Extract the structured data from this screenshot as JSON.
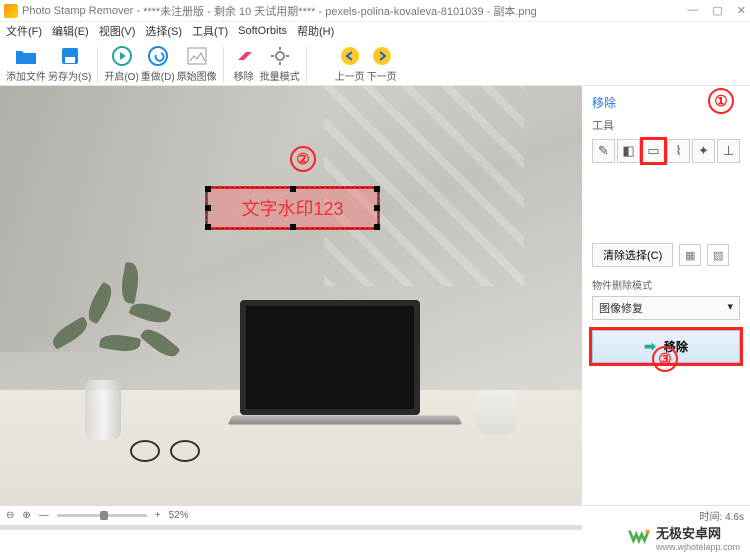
{
  "titlebar": {
    "app_name": "Photo Stamp Remover",
    "doc_status": "****未注册版 - 剩余 10 天试用期**** - pexels-polina-kovaleva-8101039 - 副本.png"
  },
  "menu": {
    "file": "文件(F)",
    "edit": "编辑(E)",
    "view": "视图(V)",
    "select": "选择(S)",
    "tools": "工具(T)",
    "softorbits": "SoftOrbits",
    "help": "帮助(H)"
  },
  "toolbar": {
    "add_file": "添加文件",
    "save_as": "另存为(S)",
    "start": "开启(O)",
    "undo": "重做(D)",
    "original": "原始图像",
    "remove": "移除",
    "batch": "批量模式",
    "prev": "上一页",
    "next": "下一页"
  },
  "canvas": {
    "watermark_text": "文字水印123"
  },
  "annotations": {
    "one": "①",
    "two": "②",
    "three": "③"
  },
  "sidebar": {
    "title": "移除",
    "tools_label": "工具",
    "palette": [
      {
        "name": "pencil-icon",
        "glyph": "✎"
      },
      {
        "name": "marker-icon",
        "glyph": "◧"
      },
      {
        "name": "rect-select-icon",
        "glyph": "▭"
      },
      {
        "name": "lasso-icon",
        "glyph": "⌇"
      },
      {
        "name": "wand-icon",
        "glyph": "✦"
      },
      {
        "name": "stamp-icon",
        "glyph": "⊥"
      }
    ],
    "clear_selection": "清除选择(C)",
    "mode_label": "物件删除模式",
    "mode_value": "图像修复",
    "remove_button": "移除"
  },
  "status": {
    "zoom_icons": "⊖ ⊕",
    "zoom_value": "52%",
    "time_label": "时间:",
    "time_value": "4.6s"
  },
  "brand": {
    "name": "无极安卓网",
    "url": "www.wjhotelapp.com"
  }
}
